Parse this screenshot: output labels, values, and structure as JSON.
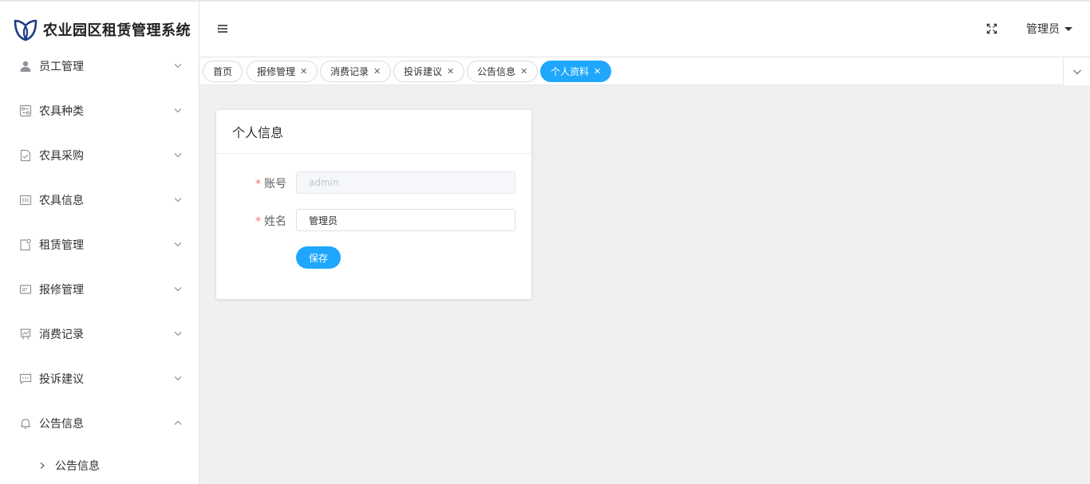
{
  "app": {
    "title": "农业园区租赁管理系统",
    "accent_color": "#1ea7fd",
    "logo_icon": "leaf-shield-logo"
  },
  "header": {
    "toggle_icon": "hamburger-icon",
    "fullscreen_icon": "fullscreen-icon",
    "user_name": "管理员"
  },
  "sidebar": {
    "items": [
      {
        "label": "员工管理",
        "icon": "user-icon",
        "expanded": false
      },
      {
        "label": "农具种类",
        "icon": "category-icon",
        "expanded": false
      },
      {
        "label": "农具采购",
        "icon": "document-check-icon",
        "expanded": false
      },
      {
        "label": "农具信息",
        "icon": "barcode-icon",
        "expanded": false
      },
      {
        "label": "租赁管理",
        "icon": "notebook-icon",
        "expanded": false
      },
      {
        "label": "报修管理",
        "icon": "ticket-icon",
        "expanded": false
      },
      {
        "label": "消费记录",
        "icon": "trend-chart-icon",
        "expanded": false
      },
      {
        "label": "投诉建议",
        "icon": "chat-dots-icon",
        "expanded": false
      },
      {
        "label": "公告信息",
        "icon": "bell-icon",
        "expanded": true
      }
    ],
    "subitems": [
      {
        "label": "公告信息"
      }
    ]
  },
  "tags": [
    {
      "label": "首页",
      "closable": false,
      "active": false
    },
    {
      "label": "报修管理",
      "closable": true,
      "active": false
    },
    {
      "label": "消费记录",
      "closable": true,
      "active": false
    },
    {
      "label": "投诉建议",
      "closable": true,
      "active": false
    },
    {
      "label": "公告信息",
      "closable": true,
      "active": false
    },
    {
      "label": "个人资料",
      "closable": true,
      "active": true
    }
  ],
  "card": {
    "title": "个人信息",
    "fields": [
      {
        "label": "账号",
        "required": true,
        "value": "admin",
        "disabled": true
      },
      {
        "label": "姓名",
        "required": true,
        "value": "管理员",
        "disabled": false
      }
    ],
    "save_label": "保存"
  }
}
